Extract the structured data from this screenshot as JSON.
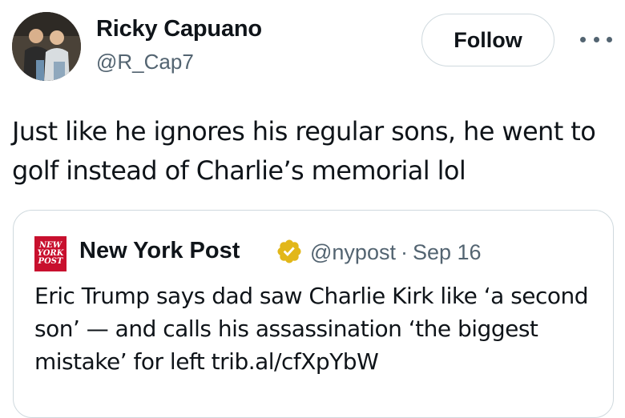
{
  "author": {
    "name": "Ricky Capuano",
    "handle": "@R_Cap7",
    "avatar_icon": "profile-photo"
  },
  "follow_label": "Follow",
  "more_icon": "more-options-icon",
  "tweet_text": "Just like he ignores his regular sons, he went to golf instead of Charlie’s memorial lol",
  "quote": {
    "logo_icon": "new-york-post-logo",
    "logo_text": [
      "NEW",
      "YORK",
      "POST"
    ],
    "name": "New York Post",
    "verified_icon": "gold-verified-badge-icon",
    "handle": "@nypost",
    "separator": "·",
    "date": "Sep 16",
    "text": "Eric Trump says dad saw Charlie Kirk like ‘a second son’ — and calls his assassination ‘the biggest mistake’ for left trib.al/cfXpYbW"
  },
  "colors": {
    "text": "#0f1419",
    "secondary": "#536471",
    "border": "#cfd9de",
    "nyp_red": "#c8102e",
    "verified_gold": "#e2b719"
  }
}
